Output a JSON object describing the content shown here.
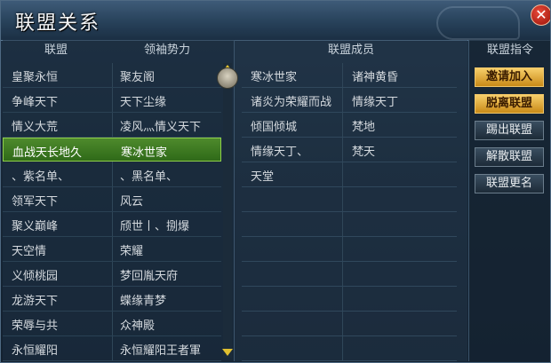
{
  "window": {
    "title": "联盟关系"
  },
  "headers": {
    "alliance": "联盟",
    "leader_force": "领袖势力",
    "members": "联盟成员",
    "commands": "联盟指令"
  },
  "alliances": [
    {
      "name": "皇聚永恒",
      "leader": "聚友阁"
    },
    {
      "name": "争峰天下",
      "leader": "天下尘缘"
    },
    {
      "name": "情义大荒",
      "leader": "凌风灬情义天下"
    },
    {
      "name": "血战天长地久",
      "leader": "寒冰世家"
    },
    {
      "name": "、紫名单、",
      "leader": "、黑名单、"
    },
    {
      "name": "领军天下",
      "leader": "风云"
    },
    {
      "name": "聚义巅峰",
      "leader": "颀世丨、捌爆"
    },
    {
      "name": "天空情",
      "leader": "荣耀"
    },
    {
      "name": "义倾桃园",
      "leader": "梦回胤天府"
    },
    {
      "name": "龙游天下",
      "leader": "蝶缘青梦"
    },
    {
      "name": "荣辱与共",
      "leader": "众神殿"
    },
    {
      "name": "永恒耀阳",
      "leader": "永恒耀阳王者軍"
    }
  ],
  "members": [
    {
      "left": "寒冰世家",
      "right": "诸神黄昏"
    },
    {
      "left": "诸炎为荣耀而战",
      "right": "情缘天丁"
    },
    {
      "left": "倾国倾城",
      "right": "梵地"
    },
    {
      "left": "情缘天丁、",
      "right": "梵天"
    },
    {
      "left": "天堂",
      "right": ""
    },
    {
      "left": "",
      "right": ""
    },
    {
      "left": "",
      "right": ""
    },
    {
      "left": "",
      "right": ""
    },
    {
      "left": "",
      "right": ""
    },
    {
      "left": "",
      "right": ""
    },
    {
      "left": "",
      "right": ""
    },
    {
      "left": "",
      "right": ""
    }
  ],
  "commands": [
    "邀请加入",
    "脱离联盟",
    "踢出联盟",
    "解散联盟",
    "联盟更名"
  ],
  "selected_index": 3,
  "colors": {
    "selected_row": "#3f7d22",
    "gold_button": "#e6b244"
  },
  "icons": {
    "close": "close-icon",
    "scroll_up": "scroll-up-icon",
    "scroll_down": "scroll-down-icon"
  }
}
